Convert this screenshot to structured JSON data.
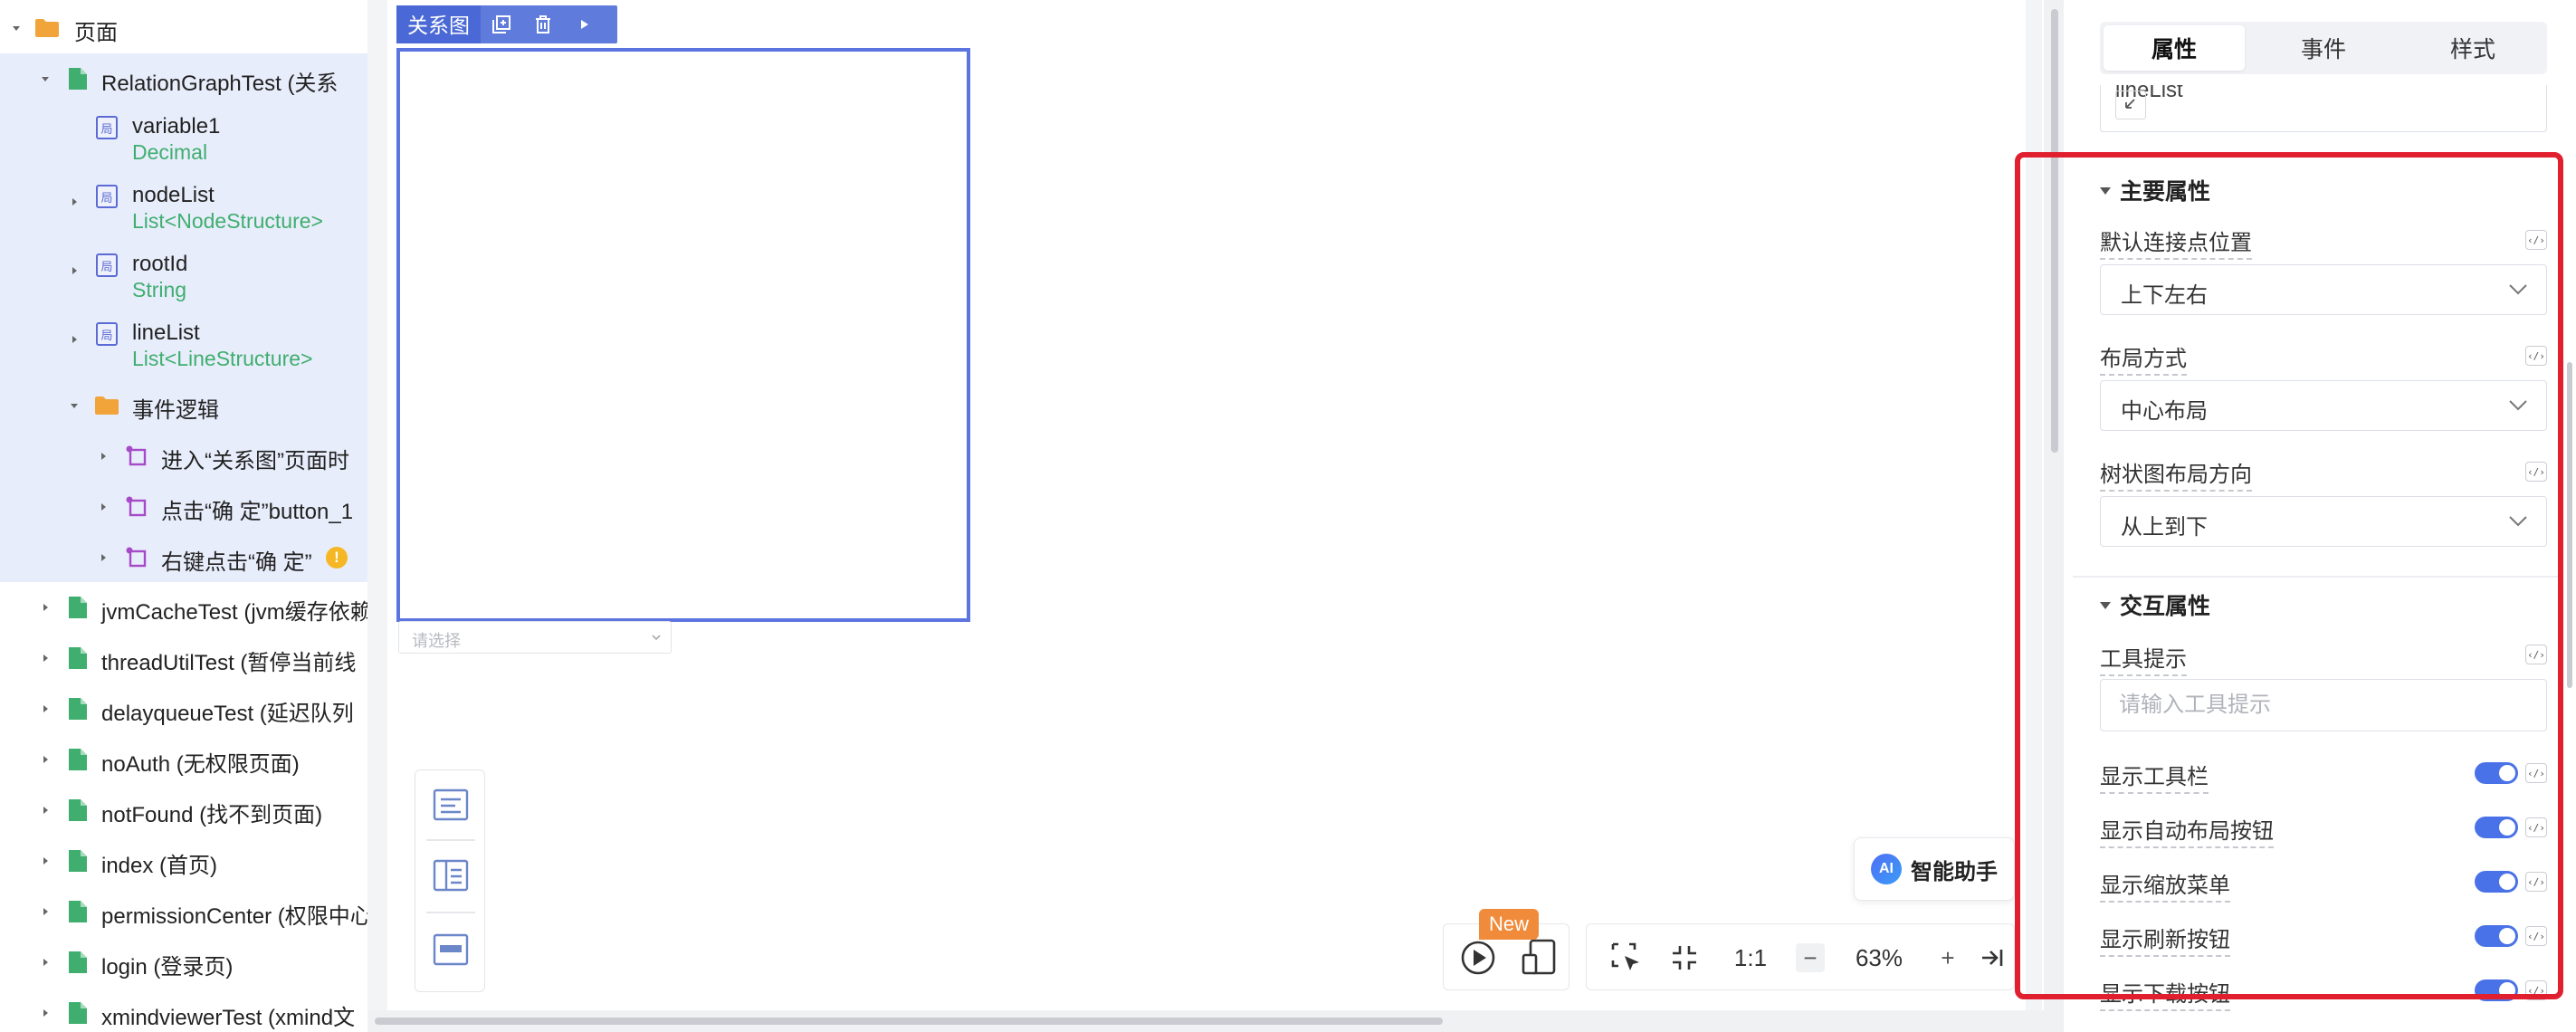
{
  "tree": {
    "root": {
      "label": "页面"
    },
    "page_active": {
      "label": "RelationGraphTest (关系"
    },
    "variables": [
      {
        "badge": "局",
        "name": "variable1",
        "type": "Decimal"
      },
      {
        "badge": "局",
        "name": "nodeList",
        "type": "List<NodeStructure>"
      },
      {
        "badge": "局",
        "name": "rootId",
        "type": "String"
      },
      {
        "badge": "局",
        "name": "lineList",
        "type": "List<LineStructure>"
      }
    ],
    "event_folder": {
      "label": "事件逻辑"
    },
    "events": [
      {
        "label": "进入“关系图”页面时"
      },
      {
        "label": "点击“确 定”button_1"
      },
      {
        "label": "右键点击“确 定”"
      }
    ],
    "warning_glyph": "!",
    "pages": [
      {
        "label": "jvmCacheTest (jvm缓存依赖"
      },
      {
        "label": "threadUtilTest (暂停当前线"
      },
      {
        "label": "delayqueueTest (延迟队列"
      },
      {
        "label": "noAuth (无权限页面)"
      },
      {
        "label": "notFound (找不到页面)"
      },
      {
        "label": "index (首页)"
      },
      {
        "label": "permissionCenter (权限中心"
      },
      {
        "label": "login (登录页)"
      },
      {
        "label": "xmindviewerTest (xmind文"
      }
    ]
  },
  "canvas": {
    "component_name": "关系图",
    "toolbar_icons": [
      "copy-icon",
      "trash-icon",
      "play-icon"
    ],
    "select_placeholder": "请选择",
    "ai_assistant": {
      "logo": "AI",
      "label": "智能助手"
    },
    "new_badge": "New",
    "zoom": {
      "ratio_label": "1:1",
      "minus": "−",
      "value": "63%",
      "plus": "+"
    }
  },
  "panel": {
    "tabs": [
      {
        "label": "属性"
      },
      {
        "label": "事件"
      },
      {
        "label": "样式"
      }
    ],
    "prev_field_value": "lineList",
    "code_glyph": "‹/›",
    "main_section": {
      "title": "主要属性",
      "fields": [
        {
          "label": "默认连接点位置",
          "value": "上下左右"
        },
        {
          "label": "布局方式",
          "value": "中心布局"
        },
        {
          "label": "树状图布局方向",
          "value": "从上到下"
        }
      ]
    },
    "interact_section": {
      "title": "交互属性",
      "tooltip_label": "工具提示",
      "tooltip_placeholder": "请输入工具提示",
      "toggles": [
        {
          "label": "显示工具栏",
          "on": true
        },
        {
          "label": "显示自动布局按钮",
          "on": true
        },
        {
          "label": "显示缩放菜单",
          "on": true
        },
        {
          "label": "显示刷新按钮",
          "on": true
        },
        {
          "label": "显示下载按钮",
          "on": true
        }
      ]
    }
  },
  "colors": {
    "accent": "#4a72e8",
    "selection_blue": "#5b74e0",
    "highlight_red": "#e0202f",
    "type_green": "#3fae6f",
    "folder_orange": "#f0a43a",
    "page_green": "#3fae6f",
    "new_badge": "#f08b3b"
  }
}
